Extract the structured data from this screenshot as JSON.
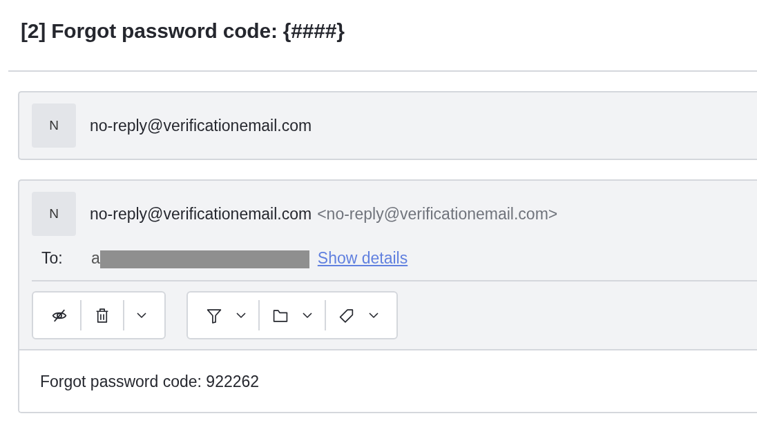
{
  "title": "[2] Forgot password code: {####}",
  "messages": [
    {
      "kind": "collapsed",
      "avatar": "N",
      "sender": "no-reply@verificationemail.com"
    },
    {
      "kind": "expanded",
      "avatar": "N",
      "sender": "no-reply@verificationemail.com",
      "sender_address": "<no-reply@verificationemail.com>",
      "to_label": "To:",
      "recipient": "a",
      "recipient_redacted": true,
      "show_details": "Show details",
      "toolbar": [
        [
          {
            "kind": "hide",
            "dropdown": false
          },
          {
            "kind": "trash",
            "dropdown": false
          },
          {
            "kind": "more",
            "dropdown": true
          }
        ],
        [
          {
            "kind": "filter",
            "dropdown": true
          },
          {
            "kind": "folder",
            "dropdown": true
          },
          {
            "kind": "tag",
            "dropdown": true
          }
        ]
      ],
      "body": "Forgot password code: 922262"
    }
  ]
}
